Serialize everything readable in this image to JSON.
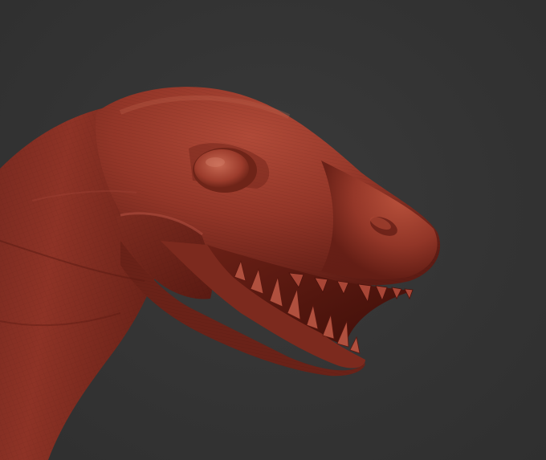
{
  "scene": {
    "subject": "dinosaur-head-sculpt",
    "background_color": "#343434",
    "material_base_color": "#8a3024",
    "material_highlight_color": "#c8604c",
    "material_shadow_color": "#4a120c",
    "mouth_interior_color": "#5a1810",
    "teeth_color": "#b0503e"
  }
}
